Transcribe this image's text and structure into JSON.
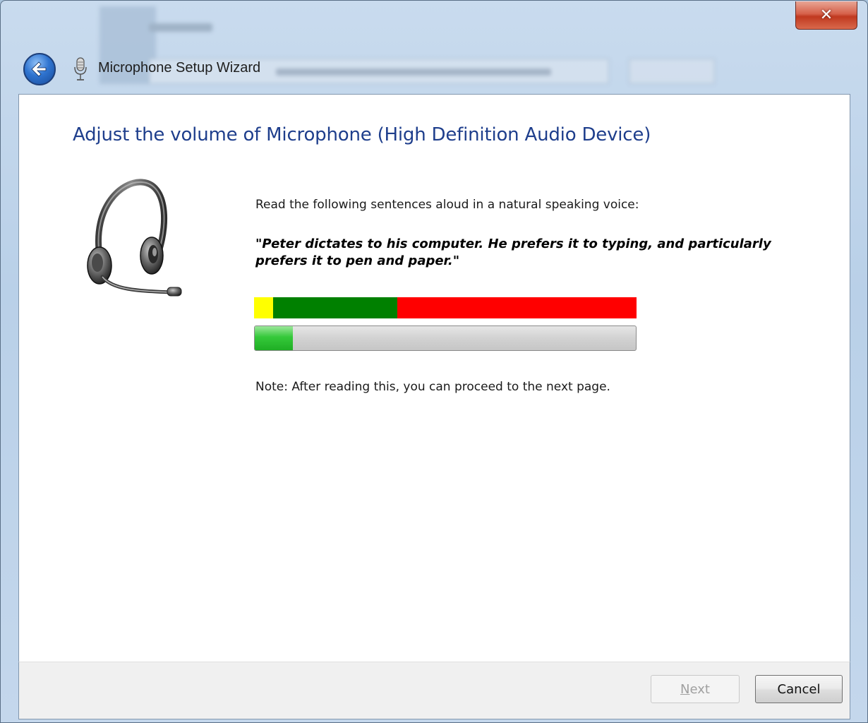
{
  "window": {
    "title": "Microphone Setup Wizard",
    "close_glyph": "✕",
    "back_icon": "back-arrow-icon",
    "title_icon": "microphone-icon"
  },
  "page": {
    "heading": "Adjust the volume of Microphone (High Definition Audio Device)",
    "illustration": "headset-icon",
    "instruction": "Read the following sentences aloud in a natural speaking voice:",
    "sentence": "\"Peter dictates to his computer. He prefers it to typing, and particularly prefers it to pen and paper.\"",
    "level_scale": {
      "segments": [
        {
          "color": "#ffff00",
          "fraction": 0.05
        },
        {
          "color": "#008000",
          "fraction": 0.325
        },
        {
          "color": "#ff0000",
          "fraction": 0.625
        }
      ]
    },
    "volume_meter": {
      "level_fraction": 0.1,
      "fill_color": "#2fc233"
    },
    "note": "Note: After reading this, you can proceed to the next page."
  },
  "footer": {
    "next_label_mnemonic": "N",
    "next_label_rest": "ext",
    "next_enabled": false,
    "cancel_label": "Cancel"
  }
}
